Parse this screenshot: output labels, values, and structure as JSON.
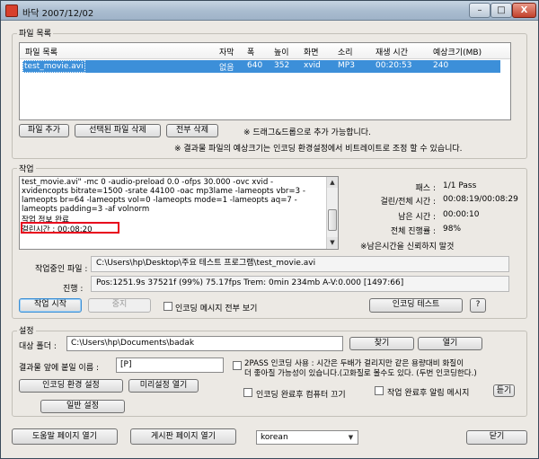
{
  "window": {
    "title": "바닥 2007/12/02",
    "controls": {
      "minimize": "–",
      "maximize": "□",
      "close": "X"
    }
  },
  "file_list": {
    "group_label": "파일 목록",
    "columns": [
      "파일 목록",
      "자막",
      "폭",
      "높이",
      "화면",
      "소리",
      "재생 시간",
      "예상크기(MB)"
    ],
    "rows": [
      [
        "test_movie.avi",
        "없음",
        "640",
        "352",
        "xvid",
        "MP3",
        "00:20:53",
        "240"
      ]
    ],
    "buttons": {
      "add": "파일 추가",
      "delete_selected": "선택된 파일 삭제",
      "delete_all": "전부 삭제"
    },
    "note_drag": "※ 드래그&드롭으로 추가 가능합니다.",
    "note_size": "※ 결과물 파일의 예상크기는 인코딩 환경설정에서 비트레이트로 조정 할 수 있습니다."
  },
  "job": {
    "group_label": "작업",
    "log_lines": [
      "test_movie.avi\" -mc 0 -audio-preload 0.0 -ofps 30.000 -ovc xvid -",
      "xvidencopts bitrate=1500 -srate 44100 -oac mp3lame -lameopts vbr=3 -",
      "lameopts br=64 -lameopts vol=0 -lameopts mode=1 -lameopts aq=7 -",
      "lameopts padding=3 -af volnorm",
      "작업 정보 완료",
      "걸린시간 : 00:08:20"
    ],
    "stats": [
      {
        "label": "패스 :",
        "value": "1/1 Pass"
      },
      {
        "label": "걸린/전체 시간 :",
        "value": "00:08:19/00:08:29"
      },
      {
        "label": "남은 시간 :",
        "value": "00:00:10"
      },
      {
        "label": "전체 진행률 :",
        "value": "98%"
      }
    ],
    "note_remaining": "※남은시간을 신뢰하지 말것",
    "current_file_label": "작업중인 파일 :",
    "current_file_value": "C:\\Users\\hp\\Desktop\\주요 테스트 프로그램\\test_movie.avi",
    "progress_label": "진행 :",
    "progress_value": "Pos:1251.9s  37521f (99%) 75.17fps Trem:    0min 234mb  A-V:0.000 [1497:66]",
    "buttons": {
      "start": "작업 시작",
      "stop": "중지",
      "encode_test": "인코딩 테스트",
      "help": "?"
    },
    "show_all_messages": {
      "label": "인코딩 메시지 전부 보기",
      "checked": false
    }
  },
  "settings": {
    "group_label": "설정",
    "target_folder_label": "대상 폴더 :",
    "target_folder_value": "C:\\Users\\hp\\Documents\\badak",
    "find_button": "찾기",
    "open_button": "열기",
    "prefix_label": "결과물 앞에 붙일 이름 :",
    "prefix_value": "[P]",
    "twopass": {
      "line1": "2PASS 인코딩 사용 : 시간은 두배가 걸리지만 같은 용량대비 화질이",
      "line2": "더 좋아질 가능성이 있습니다.(고화질로 볼수도 있다. (두번 인코딩한다.)",
      "checked": false
    },
    "buttons": {
      "encode_settings": "인코딩 환경 설정",
      "preset_open": "미리설정 열기",
      "general_settings": "일반 설정"
    },
    "shutdown_after": {
      "label": "인코딩 완료후 컴퓨터 끄기",
      "checked": false
    },
    "alarm_after": {
      "label": "작업 완료후 알림 메시지",
      "checked": false
    },
    "listen_button": "듣기"
  },
  "footer": {
    "help_page": "도움말 페이지 열기",
    "board_page": "게시판 페이지 열기",
    "language": "korean",
    "close": "닫기"
  }
}
